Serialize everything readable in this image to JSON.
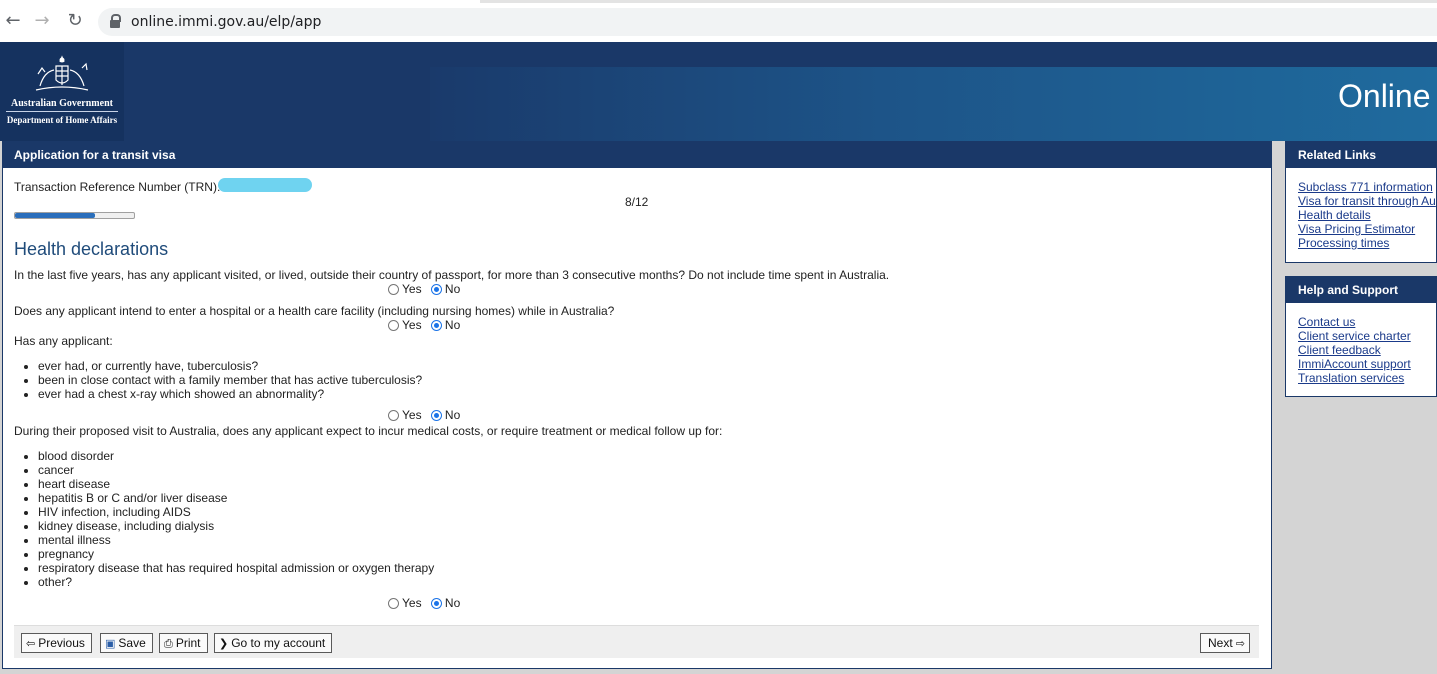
{
  "browser": {
    "back_icon": "←",
    "forward_icon": "→",
    "reload_icon": "↻",
    "url": "online.immi.gov.au/elp/app"
  },
  "header": {
    "gov_line1": "Australian Government",
    "gov_line2": "Department of Home Affairs",
    "site_title": "Online"
  },
  "main": {
    "panel_title": "Application for a transit visa",
    "trn_label": "Transaction Reference Number (TRN):",
    "step": "8/12",
    "progress_fraction": 0.67,
    "section_title": "Health declarations",
    "yes_label": "Yes",
    "no_label": "No",
    "questions": [
      {
        "text": "In the last five years, has any applicant visited, or lived, outside their country of passport, for more than 3 consecutive months? Do not include time spent in Australia.",
        "answer": "No"
      },
      {
        "text": "Does any applicant intend to enter a hospital or a health care facility (including nursing homes) while in Australia?",
        "answer": "No"
      },
      {
        "text": "Has any applicant:",
        "items": [
          "ever had, or currently have, tuberculosis?",
          "been in close contact with a family member that has active tuberculosis?",
          "ever had a chest x-ray which showed an abnormality?"
        ],
        "answer": "No"
      },
      {
        "text": "During their proposed visit to Australia, does any applicant expect to incur medical costs, or require treatment or medical follow up for:",
        "items": [
          "blood disorder",
          "cancer",
          "heart disease",
          "hepatitis B or C and/or liver disease",
          "HIV infection, including AIDS",
          "kidney disease, including dialysis",
          "mental illness",
          "pregnancy",
          "respiratory disease that has required hospital admission or oxygen therapy",
          "other?"
        ],
        "answer": "No"
      }
    ],
    "buttons": {
      "previous": "Previous",
      "save": "Save",
      "print": "Print",
      "account": "Go to my account",
      "next": "Next"
    }
  },
  "sidebar": {
    "related": {
      "title": "Related Links",
      "links": [
        "Subclass 771 information",
        "Visa for transit through Au",
        "Health details",
        "Visa Pricing Estimator",
        "Processing times"
      ]
    },
    "help": {
      "title": "Help and Support",
      "links": [
        "Contact us",
        "Client service charter",
        "Client feedback",
        "ImmiAccount support",
        "Translation services"
      ]
    }
  },
  "colors": {
    "header_navy": "#1a3868",
    "link": "#1a3a8a",
    "radio_selected": "#1a73e8",
    "progress": "#2a6ebb"
  }
}
